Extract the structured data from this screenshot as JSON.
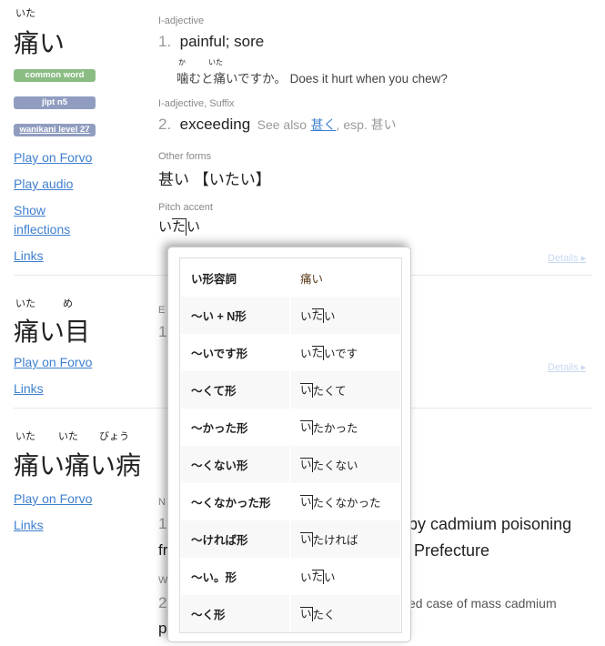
{
  "entries": [
    {
      "furigana": [
        "いた"
      ],
      "word": "痛い",
      "badges": {
        "common": "common word",
        "jlpt": "jlpt n5",
        "wanikani": "wanikani level 27"
      },
      "links": {
        "forvo": "Play on Forvo",
        "audio": "Play audio",
        "show": "Show",
        "inflections": "inflections",
        "links": "Links"
      },
      "senses": [
        {
          "tags": "I-adjective",
          "num": "1.",
          "meaning": "painful; sore",
          "sentence": {
            "furi1": "か",
            "furi2": "いた",
            "ja": "噛むと痛いですか。",
            "en": "Does it hurt when you chew?"
          }
        },
        {
          "tags": "I-adjective, Suffix",
          "num": "2.",
          "meaning": "exceeding",
          "see_also": "See also",
          "see_link": "甚く",
          "esp": ", esp. 甚い"
        }
      ],
      "other_forms_label": "Other forms",
      "other_forms": "甚い 【いたい】",
      "pitch_label": "Pitch accent",
      "pitch": {
        "pre": "い",
        "high": "た",
        "post": "い"
      },
      "details": "Details ▸"
    },
    {
      "furigana": [
        "いた",
        "め"
      ],
      "word": "痛い目",
      "links": {
        "forvo": "Play on Forvo",
        "links": "Links"
      },
      "frags": [
        "E",
        "1"
      ],
      "details": "Details ▸"
    },
    {
      "furigana": [
        "いた",
        "いた",
        "びょう"
      ],
      "word": "痛い痛い病",
      "links": {
        "forvo": "Play on Forvo",
        "links": "Links"
      },
      "frags": [
        "N",
        "1",
        "fr",
        "W",
        "2",
        "p"
      ],
      "right": [
        "by cadmium poisoning",
        "Prefecture",
        "ed case of mass cadmium"
      ]
    }
  ],
  "inflection_popup": {
    "header": {
      "form": "い形容詞",
      "value": "痛い"
    },
    "rows": [
      {
        "form": "〜い + N形",
        "pre": "い",
        "high": "た",
        "post": "い"
      },
      {
        "form": "〜いです形",
        "pre": "い",
        "high": "た",
        "post": "いです"
      },
      {
        "form": "〜くて形",
        "pre": "",
        "high": "い",
        "post": "たくて"
      },
      {
        "form": "〜かった形",
        "pre": "",
        "high": "い",
        "post": "たかった"
      },
      {
        "form": "〜くない形",
        "pre": "",
        "high": "い",
        "post": "たくない"
      },
      {
        "form": "〜くなかった形",
        "pre": "",
        "high": "い",
        "post": "たくなかった"
      },
      {
        "form": "〜ければ形",
        "pre": "",
        "high": "い",
        "post": "たければ"
      },
      {
        "form": "〜い。形",
        "pre": "い",
        "high": "た",
        "post": "い"
      },
      {
        "form": "〜く形",
        "pre": "",
        "high": "い",
        "post": "たく"
      }
    ]
  },
  "colors": {
    "common": "#8abc83",
    "jlpt": "#909dc0",
    "link": "#3f7fcf"
  }
}
